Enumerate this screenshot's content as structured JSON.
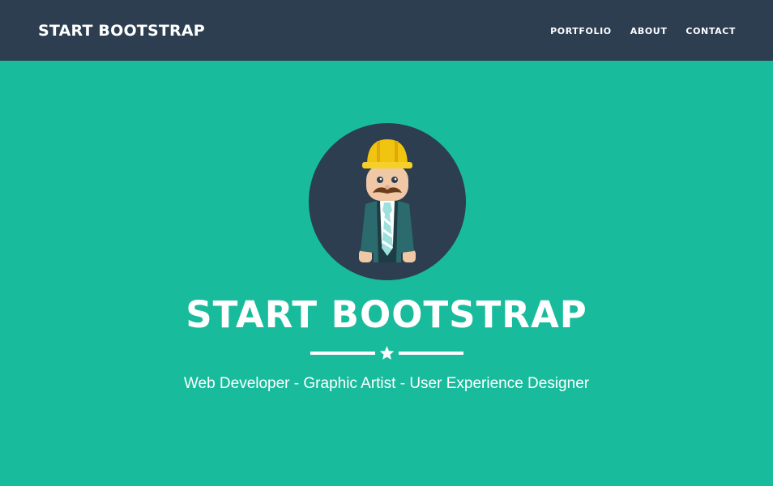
{
  "navbar": {
    "brand": "START BOOTSTRAP",
    "links": [
      "PORTFOLIO",
      "ABOUT",
      "CONTACT"
    ]
  },
  "hero": {
    "avatar_icon": "developer-avatar-icon",
    "title": "START BOOTSTRAP",
    "divider_icon": "star-icon",
    "subtitle": "Web Developer - Graphic Artist - User Experience Designer"
  },
  "colors": {
    "navbar_bg": "#2c3e50",
    "hero_bg": "#18bc9c",
    "text": "#ffffff",
    "hardhat": "#f1c40f",
    "jacket": "#2b6b6e"
  }
}
